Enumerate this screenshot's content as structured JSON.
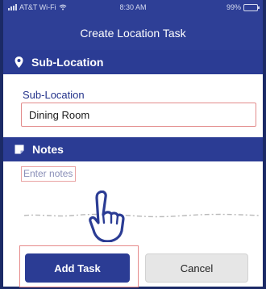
{
  "status_bar": {
    "carrier": "AT&T Wi-Fi",
    "time": "8:30 AM",
    "battery": "99%"
  },
  "nav": {
    "title": "Create Location Task"
  },
  "sublocation": {
    "section_title": "Sub-Location",
    "field_label": "Sub-Location",
    "value": "Dining Room"
  },
  "notes": {
    "section_title": "Notes",
    "placeholder": "Enter notes"
  },
  "actions": {
    "add_label": "Add Task",
    "cancel_label": "Cancel"
  },
  "colors": {
    "primary": "#2e3f96",
    "highlight_outline": "#e28b8b"
  },
  "icons": [
    "wifi-icon",
    "location-pin-icon",
    "notes-icon",
    "pointing-hand-icon",
    "battery-icon"
  ]
}
